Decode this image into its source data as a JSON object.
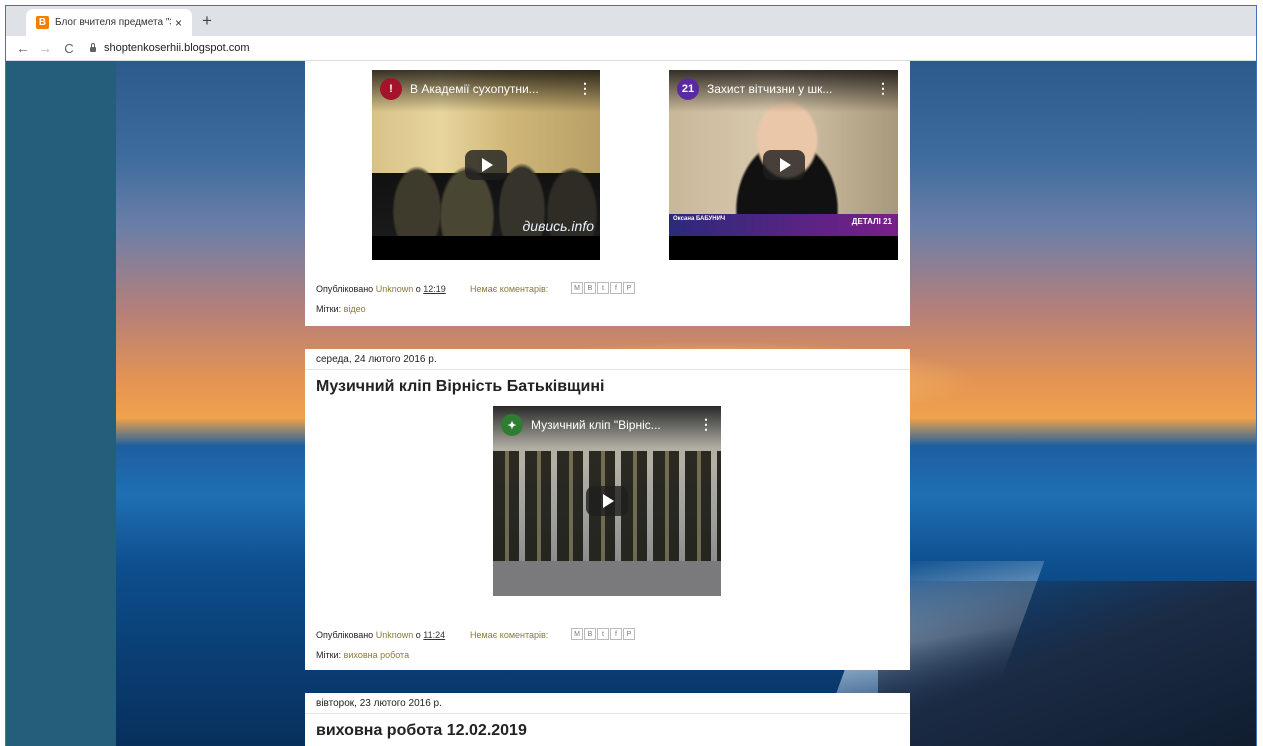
{
  "browser": {
    "tab_title": "Блог вчителя предмета \"Захист",
    "tab_close": "×",
    "new_tab": "+",
    "url": "shoptenkoserhii.blogspot.com",
    "nav": {
      "back": "←",
      "forward": "→",
      "reload": "C"
    }
  },
  "posts": [
    {
      "videos": [
        {
          "title": "В Академії сухопутни...",
          "channel_badge": "!",
          "watermark": "дивись.info"
        },
        {
          "title": "Захист вітчизни у шк...",
          "channel_badge": "21",
          "lower_third_name": "Оксана БАБУНИЧ",
          "lower_third_brand": "ДЕТАЛІ 21"
        }
      ],
      "published_prefix": "Опубліковано",
      "author": "Unknown",
      "at": "о",
      "time": "12:19",
      "comments": "Немає коментарів:",
      "labels_prefix": "Мітки:",
      "labels": "відео"
    },
    {
      "date": "середа, 24 лютого 2016 р.",
      "title": "Музичний кліп Вірність Батьківщині",
      "video": {
        "title": "Музичний кліп \"Вірніс...",
        "channel_badge": "✦"
      },
      "published_prefix": "Опубліковано",
      "author": "Unknown",
      "at": "о",
      "time": "11:24",
      "comments": "Немає коментарів:",
      "labels_prefix": "Мітки:",
      "labels": "виховна робота"
    },
    {
      "date": "вівторок, 23 лютого 2016 р.",
      "title": "виховна робота 12.02.2019"
    }
  ],
  "share_icons": [
    "M",
    "B",
    "t",
    "f",
    "P"
  ],
  "colors": {
    "accent_link": "#8a7a3a",
    "page_side": "#235f7a",
    "tab_strip": "#dee1e6"
  }
}
